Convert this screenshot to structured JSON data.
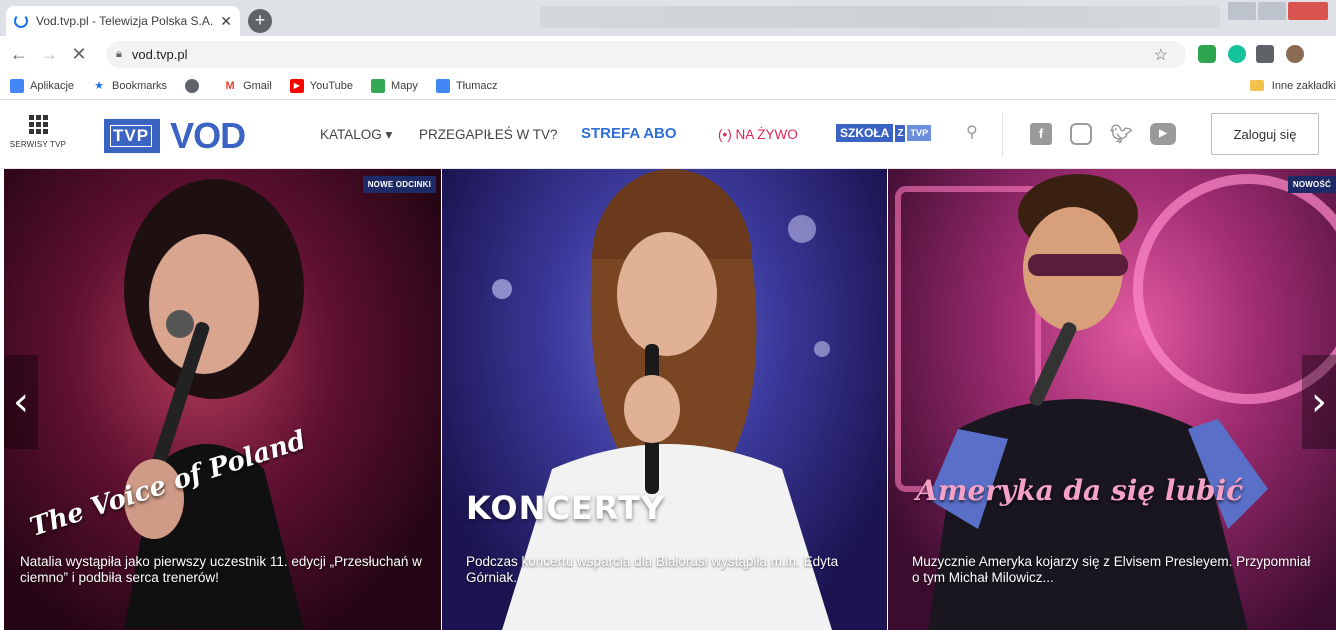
{
  "browser": {
    "tab_title": "Vod.tvp.pl - Telewizja Polska S.A.",
    "tab_close": "✕",
    "new_tab": "+",
    "url": "vod.tvp.pl",
    "bookmarks": [
      {
        "label": "Aplikacje",
        "icon": "apps-grid-icon",
        "color": "#4285f4"
      },
      {
        "label": "Bookmarks",
        "icon": "star-icon",
        "color": "#1a73e8"
      },
      {
        "label": "",
        "icon": "globe-icon",
        "color": "#5f6368"
      },
      {
        "label": "Gmail",
        "icon": "gmail-icon",
        "color": "#ea4335"
      },
      {
        "label": "YouTube",
        "icon": "youtube-icon",
        "color": "#ff0000"
      },
      {
        "label": "Mapy",
        "icon": "maps-icon",
        "color": "#34a853"
      },
      {
        "label": "Tłumacz",
        "icon": "translate-icon",
        "color": "#4285f4"
      }
    ],
    "other_bookmarks": "Inne zakładki"
  },
  "header": {
    "services_label": "SERWISY TVP",
    "logo_tvp": "TVP",
    "logo_vod": "VOD",
    "nav": {
      "katalog": "KATALOG ▾",
      "przegapiles": "PRZEGAPIŁEŚ W TV?",
      "strefa_abo": "STREFA ABO",
      "live": "(•) NA ŻYWO",
      "szkola_1": "SZKOŁA",
      "szkola_2": "Z",
      "szkola_3": "TVP"
    },
    "social": [
      "facebook-icon",
      "instagram-icon",
      "twitter-icon",
      "youtube-icon"
    ],
    "login_label": "Zaloguj się"
  },
  "slides": [
    {
      "badge": "NOWE ODCINKI",
      "show_logo": "The Voice of Poland",
      "caption": "Natalia wystąpiła jako pierwszy uczestnik 11. edycji „Przesłuchań w ciemno” i podbiła serca trenerów!"
    },
    {
      "badge": "",
      "title": "KONCERTY",
      "caption": "Podczas koncertu wsparcia dla Białorusi wystąpiła m.in. Edyta Górniak."
    },
    {
      "badge": "NOWOŚĆ",
      "show_logo": "Ameryka da się lubić",
      "caption": "Muzycznie Ameryka kojarzy się z Elvisem Presleyem. Przypomniał o tym Michał Milowicz..."
    }
  ],
  "colors": {
    "brand_blue": "#3b63c4",
    "live_red": "#e0245e",
    "abo_blue": "#2f6fd8",
    "badge_navy": "#1e2a66"
  }
}
